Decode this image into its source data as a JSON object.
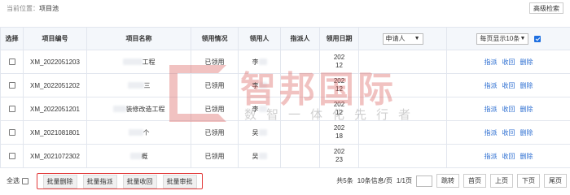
{
  "breadcrumb": {
    "prefix": "当前位置：",
    "current": "项目池"
  },
  "advanced_search_label": "高级检索",
  "columns": {
    "select": "选择",
    "code": "项目编号",
    "name": "项目名称",
    "claim_status": "领用情况",
    "claimant": "领用人",
    "assignee": "指派人",
    "claim_date": "领用日期",
    "applicant_filter": "申请人",
    "page_size": "每页显示10条"
  },
  "rows": [
    {
      "code": "XM_2022051203",
      "name": "工程",
      "status": "已领用",
      "claimant": "李",
      "date1": "202",
      "date2": "12",
      "actions": [
        "指派",
        "收回",
        "删除"
      ]
    },
    {
      "code": "XM_2022051202",
      "name": "三",
      "status": "已领用",
      "claimant": "李",
      "date1": "202",
      "date2": "12",
      "actions": [
        "指派",
        "收回",
        "删除"
      ]
    },
    {
      "code": "XM_2022051201",
      "name": "装修改造工程",
      "status": "已领用",
      "claimant": "李",
      "date1": "202",
      "date2": "12",
      "actions": [
        "指派",
        "收回",
        "删除"
      ]
    },
    {
      "code": "XM_2021081801",
      "name": "个",
      "status": "已领用",
      "claimant": "吴",
      "date1": "202",
      "date2": "18",
      "actions": [
        "指派",
        "收回",
        "删除"
      ]
    },
    {
      "code": "XM_2021072302",
      "name": "概",
      "status": "已领用",
      "claimant": "吴",
      "date1": "202",
      "date2": "23",
      "actions": [
        "指派",
        "收回",
        "删除"
      ]
    }
  ],
  "watermark": {
    "title": "智邦国际",
    "subtitle": "数智一体化先行者"
  },
  "footer": {
    "select_all": "全选",
    "batch": [
      "批量删除",
      "批量指派",
      "批量收回",
      "批量审批"
    ],
    "summary": "共5条",
    "per_page": "10条信息/页",
    "pages": "1/1页",
    "jump": "跳转",
    "first": "首页",
    "prev": "上页",
    "next": "下页",
    "last": "尾页"
  },
  "colors": {
    "link": "#2c6ed1",
    "highlight_border": "#e23a3a",
    "watermark_red": "#d9534f"
  }
}
